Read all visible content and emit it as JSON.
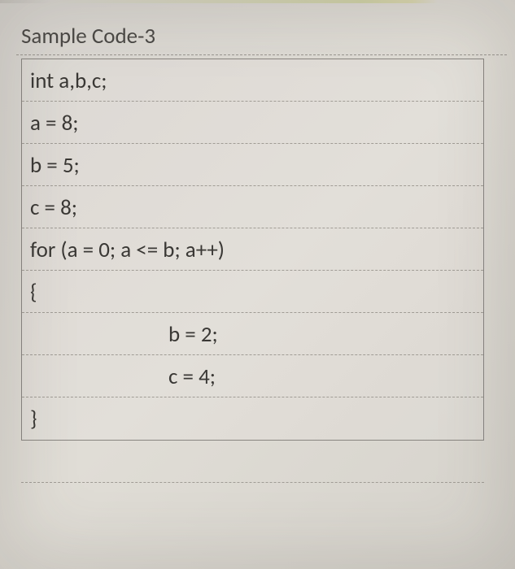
{
  "title": "Sample Code-3",
  "code_lines": {
    "line0": "int a,b,c;",
    "line1": "a = 8;",
    "line2": "b = 5;",
    "line3": "c = 8;",
    "line4": "for (a = 0; a <= b; a++)",
    "line5": "{",
    "line6": "b = 2;",
    "line7": "c = 4;",
    "line8": "}"
  }
}
